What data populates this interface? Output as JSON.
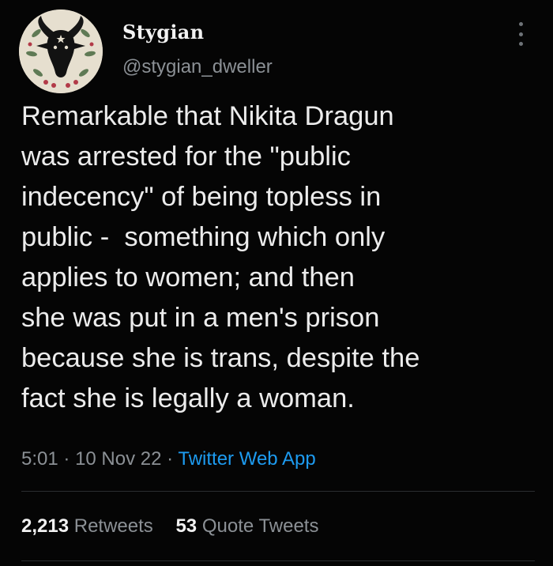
{
  "user": {
    "display_name": "Stygian",
    "handle": "@stygian_dweller",
    "avatar_icon": "goat-skull-avatar-icon"
  },
  "more_icon": "more-vertical-icon",
  "tweet": {
    "lines": [
      "Remarkable that Nikita Dragun",
      "was arrested for the \"public",
      "indecency\" of being topless in",
      "public -  something which only",
      "applies to women; and then",
      "she was put in a men's prison",
      "because she is trans, despite the",
      "fact she is legally a woman."
    ],
    "time": "5:01",
    "separator": "·",
    "date": "10 Nov 22",
    "source": "Twitter Web App"
  },
  "stats": {
    "retweets_count": "2,213",
    "retweets_label": "Retweets",
    "quotes_count": "53",
    "quotes_label": "Quote Tweets"
  },
  "colors": {
    "background": "#050505",
    "text": "#ececec",
    "muted": "#8b9095",
    "link": "#1d9bf0",
    "divider": "#2a2d30"
  }
}
